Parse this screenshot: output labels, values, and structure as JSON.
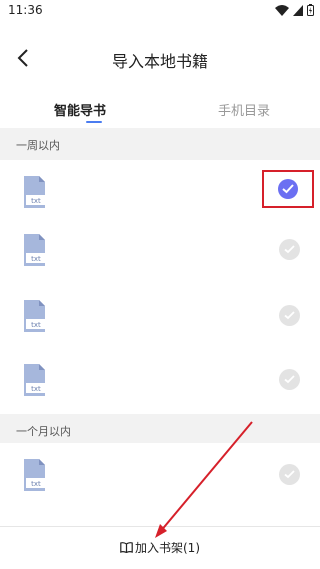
{
  "status": {
    "time": "11:36"
  },
  "header": {
    "title": "导入本地书籍"
  },
  "tabs": [
    {
      "label": "智能导书",
      "active": true
    },
    {
      "label": "手机目录",
      "active": false
    }
  ],
  "sections": [
    {
      "label": "一周以内",
      "files": [
        {
          "type": "txt",
          "selected": true
        },
        {
          "type": "txt",
          "selected": false
        },
        {
          "type": "txt",
          "selected": false
        },
        {
          "type": "txt",
          "selected": false
        }
      ]
    },
    {
      "label": "一个月以内",
      "files": [
        {
          "type": "txt",
          "selected": false
        }
      ]
    }
  ],
  "bottom": {
    "add_to_shelf": "加入书架(1)"
  },
  "colors": {
    "accent": "#4a7cf0",
    "check_selected": "#6b6ff2",
    "annotation": "#d6202a"
  }
}
